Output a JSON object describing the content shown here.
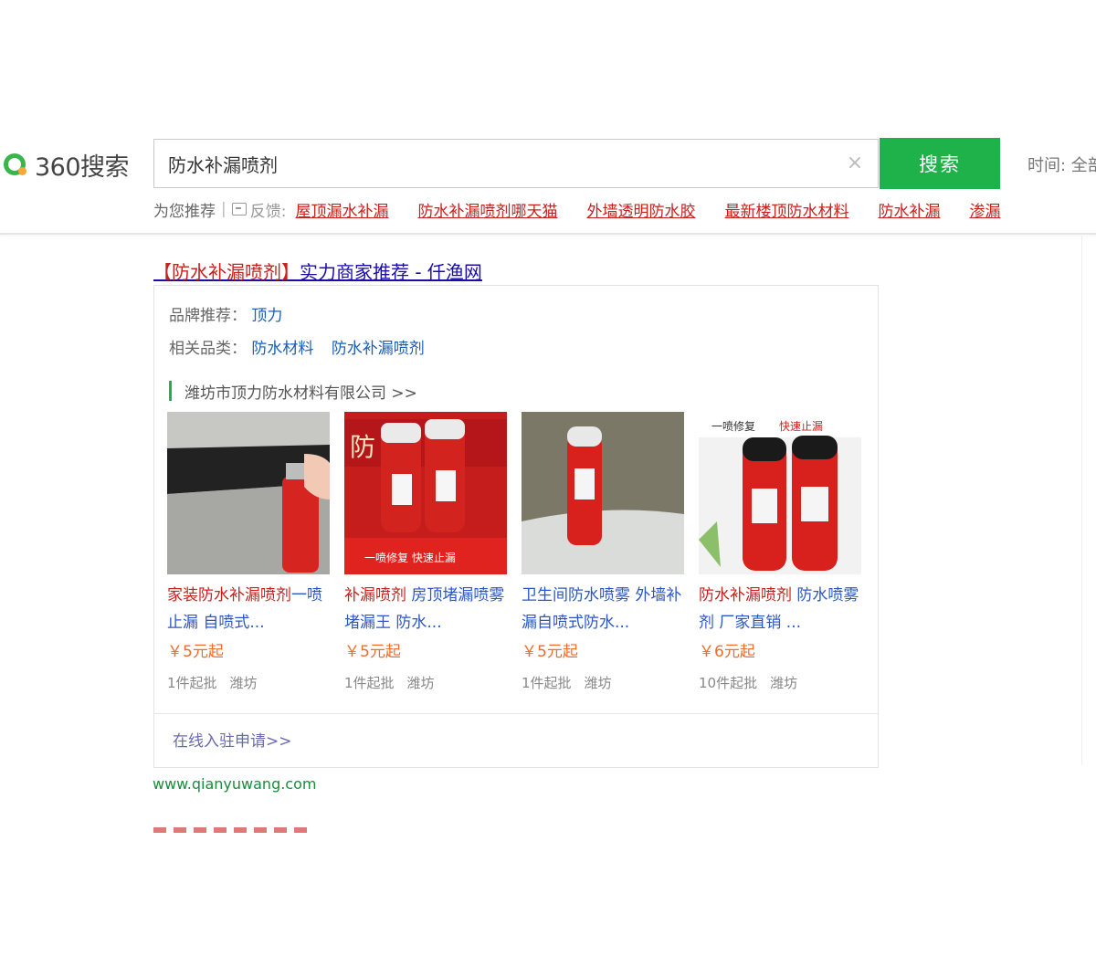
{
  "header": {
    "logo_text": "360搜索",
    "search_value": "防水补漏喷剂",
    "search_button": "搜索",
    "time_filter": "时间: 全部"
  },
  "suggestions": {
    "label": "为您推荐",
    "separator": "|",
    "feedback": "反馈:",
    "items": [
      "屋顶漏水补漏",
      "防水补漏喷剂哪天猫",
      "外墙透明防水胶",
      "最新楼顶防水材料",
      "防水补漏",
      "渗漏"
    ]
  },
  "result": {
    "title_highlight": "【防水补漏喷剂】",
    "title_rest": "实力商家推荐 - 仟渔网",
    "brand_label": "品牌推荐：",
    "brand_link": "顶力",
    "category_label": "相关品类：",
    "category_links": [
      "防水材料",
      "防水补漏喷剂"
    ],
    "company": "潍坊市顶力防水材料有限公司 >>",
    "products": [
      {
        "name_hl": "家装防水补漏喷剂",
        "name_rest": "一喷止漏 自喷式...",
        "price": "￥5元起",
        "min_order": "1件起批",
        "location": "潍坊"
      },
      {
        "name_hl": "补漏喷剂",
        "name_rest": " 房顶堵漏喷雾堵漏王 防水...",
        "price": "￥5元起",
        "min_order": "1件起批",
        "location": "潍坊"
      },
      {
        "name_hl": "",
        "name_rest": "卫生间防水喷雾 外墙补漏自喷式防水...",
        "price": "￥5元起",
        "min_order": "1件起批",
        "location": "潍坊"
      },
      {
        "name_hl": "防水补漏喷剂",
        "name_rest": " 防水喷雾剂 厂家直销 ...",
        "price": "￥6元起",
        "min_order": "10件起批",
        "location": "潍坊"
      }
    ],
    "image_texts": {
      "p2_sign": "防 剂",
      "p2_bottom": "一喷修复  快速止漏",
      "p4_banner_left": "一喷修复",
      "p4_banner_right": "快速止漏"
    },
    "apply_link": "在线入驻申请>>",
    "url": "www.qianyuwang.com"
  },
  "colors": {
    "brand_green": "#1fb14a",
    "link_blue": "#1a0dab",
    "highlight_red": "#c9201c",
    "price_orange": "#f26c2a",
    "url_green": "#198c3e"
  }
}
